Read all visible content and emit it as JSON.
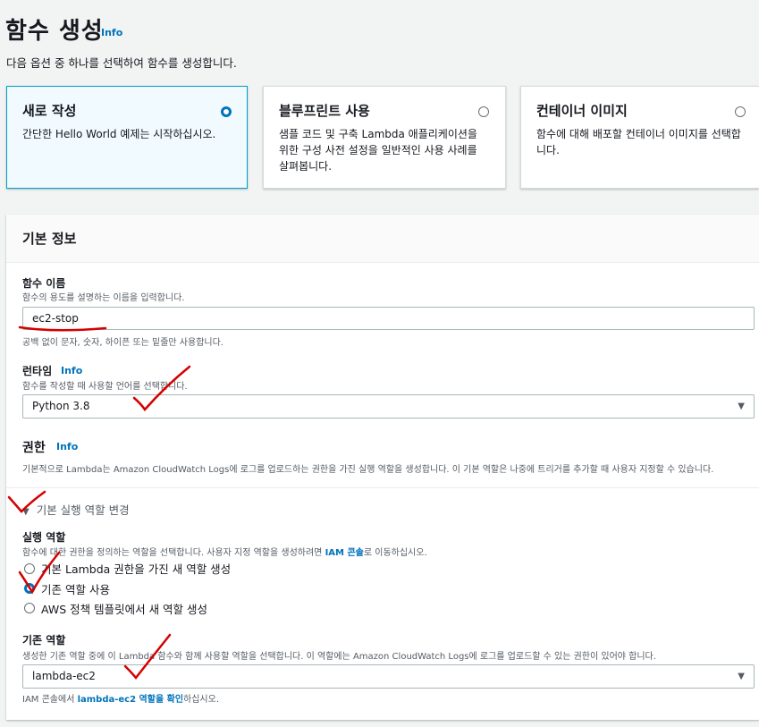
{
  "header": {
    "title": "함수 생성",
    "info": "Info",
    "subtitle": "다음 옵션 중 하나를 선택하여 함수를 생성합니다."
  },
  "options": [
    {
      "title": "새로 작성",
      "desc": "간단한 Hello World 예제는 시작하십시오.",
      "selected": true
    },
    {
      "title": "블루프린트 사용",
      "desc": "샘플 코드 및 구축 Lambda 애플리케이션을 위한 구성 사전 설정을 일반적인 사용 사례를 살펴봅니다.",
      "selected": false
    },
    {
      "title": "컨테이너 이미지",
      "desc": "함수에 대해 배포할 컨테이너 이미지를 선택합니다.",
      "selected": false
    }
  ],
  "basic_info": {
    "title": "기본 정보",
    "function_name": {
      "label": "함수 이름",
      "desc": "함수의 용도를 설명하는 이름을 입력합니다.",
      "value": "ec2-stop",
      "hint": "공백 없이 문자, 숫자, 하이픈 또는 밑줄만 사용합니다."
    },
    "runtime": {
      "label": "런타임",
      "info": "Info",
      "desc": "함수를 작성할 때 사용할 언어를 선택합니다.",
      "value": "Python 3.8"
    },
    "permissions": {
      "label": "권한",
      "info": "Info",
      "desc": "기본적으로 Lambda는 Amazon CloudWatch Logs에 로그를 업로드하는 권한을 가진 실행 역할을 생성합니다. 이 기본 역할은 나중에 트리거를 추가할 때 사용자 지정할 수 있습니다."
    },
    "change_role": {
      "label": "기본 실행 역할 변경",
      "exec_role_label": "실행 역할",
      "exec_role_desc_a": "함수에 대한 권한을 정의하는 역할을 선택합니다. 사용자 지정 역할을 생성하려면 ",
      "exec_role_desc_link": "IAM 콘솔",
      "exec_role_desc_b": "로 이동하십시오.",
      "radios": [
        {
          "label": "기본 Lambda 권한을 가진 새 역할 생성",
          "selected": false
        },
        {
          "label": "기존 역할 사용",
          "selected": true
        },
        {
          "label": "AWS 정책 템플릿에서 새 역할 생성",
          "selected": false
        }
      ]
    },
    "existing_role": {
      "label": "기존 역할",
      "desc": "생성한 기존 역할 중에 이 Lambda 함수와 함께 사용할 역할을 선택합니다. 이 역할에는 Amazon CloudWatch Logs에 로그를 업로드할 수 있는 권한이 있어야 합니다.",
      "value": "lambda-ec2",
      "footer_a": "IAM 콘솔에서 ",
      "footer_link": "lambda-ec2 역할을 확인",
      "footer_b": "하십시오."
    }
  },
  "colors": {
    "accent": "#0073bb",
    "annotation": "#d50000",
    "selected_bg": "#f1faff"
  },
  "icons": {
    "select_arrow": "caret-down-icon",
    "expand": "triangle-down-icon"
  }
}
